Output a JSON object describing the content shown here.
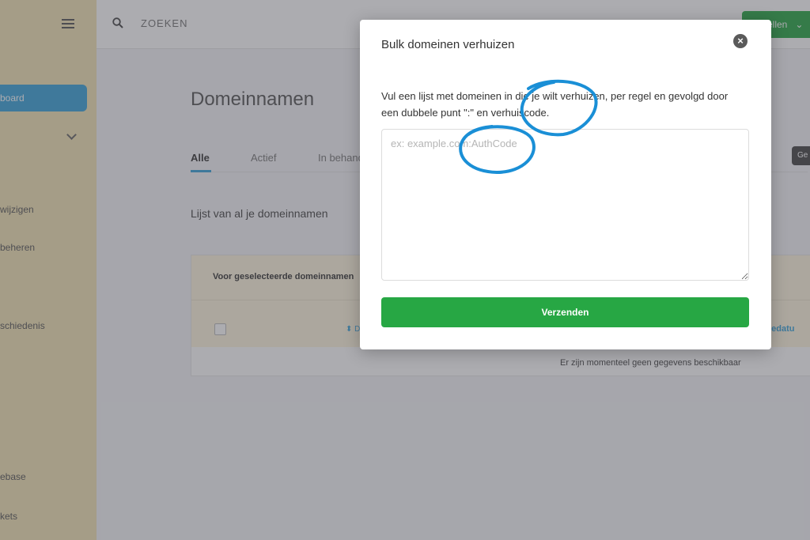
{
  "sidebar": {
    "active_item": "board",
    "items": [
      {
        "label": "wijzigen"
      },
      {
        "label": "beheren"
      },
      {
        "label": "schiedenis"
      },
      {
        "label": "ebase"
      },
      {
        "label": "kets"
      }
    ]
  },
  "topbar": {
    "search_placeholder": "ZOEKEN",
    "action_button": "ellen"
  },
  "page": {
    "title": "Domeinnamen",
    "tabs": [
      {
        "label": "Alle"
      },
      {
        "label": "Actief"
      },
      {
        "label": "In behand"
      }
    ],
    "tooltip": "Ge",
    "subtitle": "Lijst van al je domeinnamen"
  },
  "table": {
    "bulk_label": "Voor geselecteerde domeinnamen",
    "col_registration": "ratiedatu",
    "empty_text": "Er zijn momenteel geen gegevens beschikbaar"
  },
  "modal": {
    "title": "Bulk domeinen verhuizen",
    "description": "Vul een lijst met domeinen in die je wilt verhuizen, per regel en gevolgd door een dubbele punt \":\" en verhuiscode.",
    "textarea_placeholder": "ex: example.com:AuthCode",
    "submit_label": "Verzenden",
    "close_symbol": "×"
  },
  "colors": {
    "accent_blue": "#3aa3d9",
    "primary_green": "#27a744",
    "sidebar_bg": "#f2e3b5",
    "annotation_blue": "#1a8fd6"
  },
  "icons": {
    "menu": "hamburger-icon",
    "search": "search-icon",
    "close": "close-icon",
    "dropdown": "chevron-down-icon",
    "sort": "sort-icon"
  }
}
